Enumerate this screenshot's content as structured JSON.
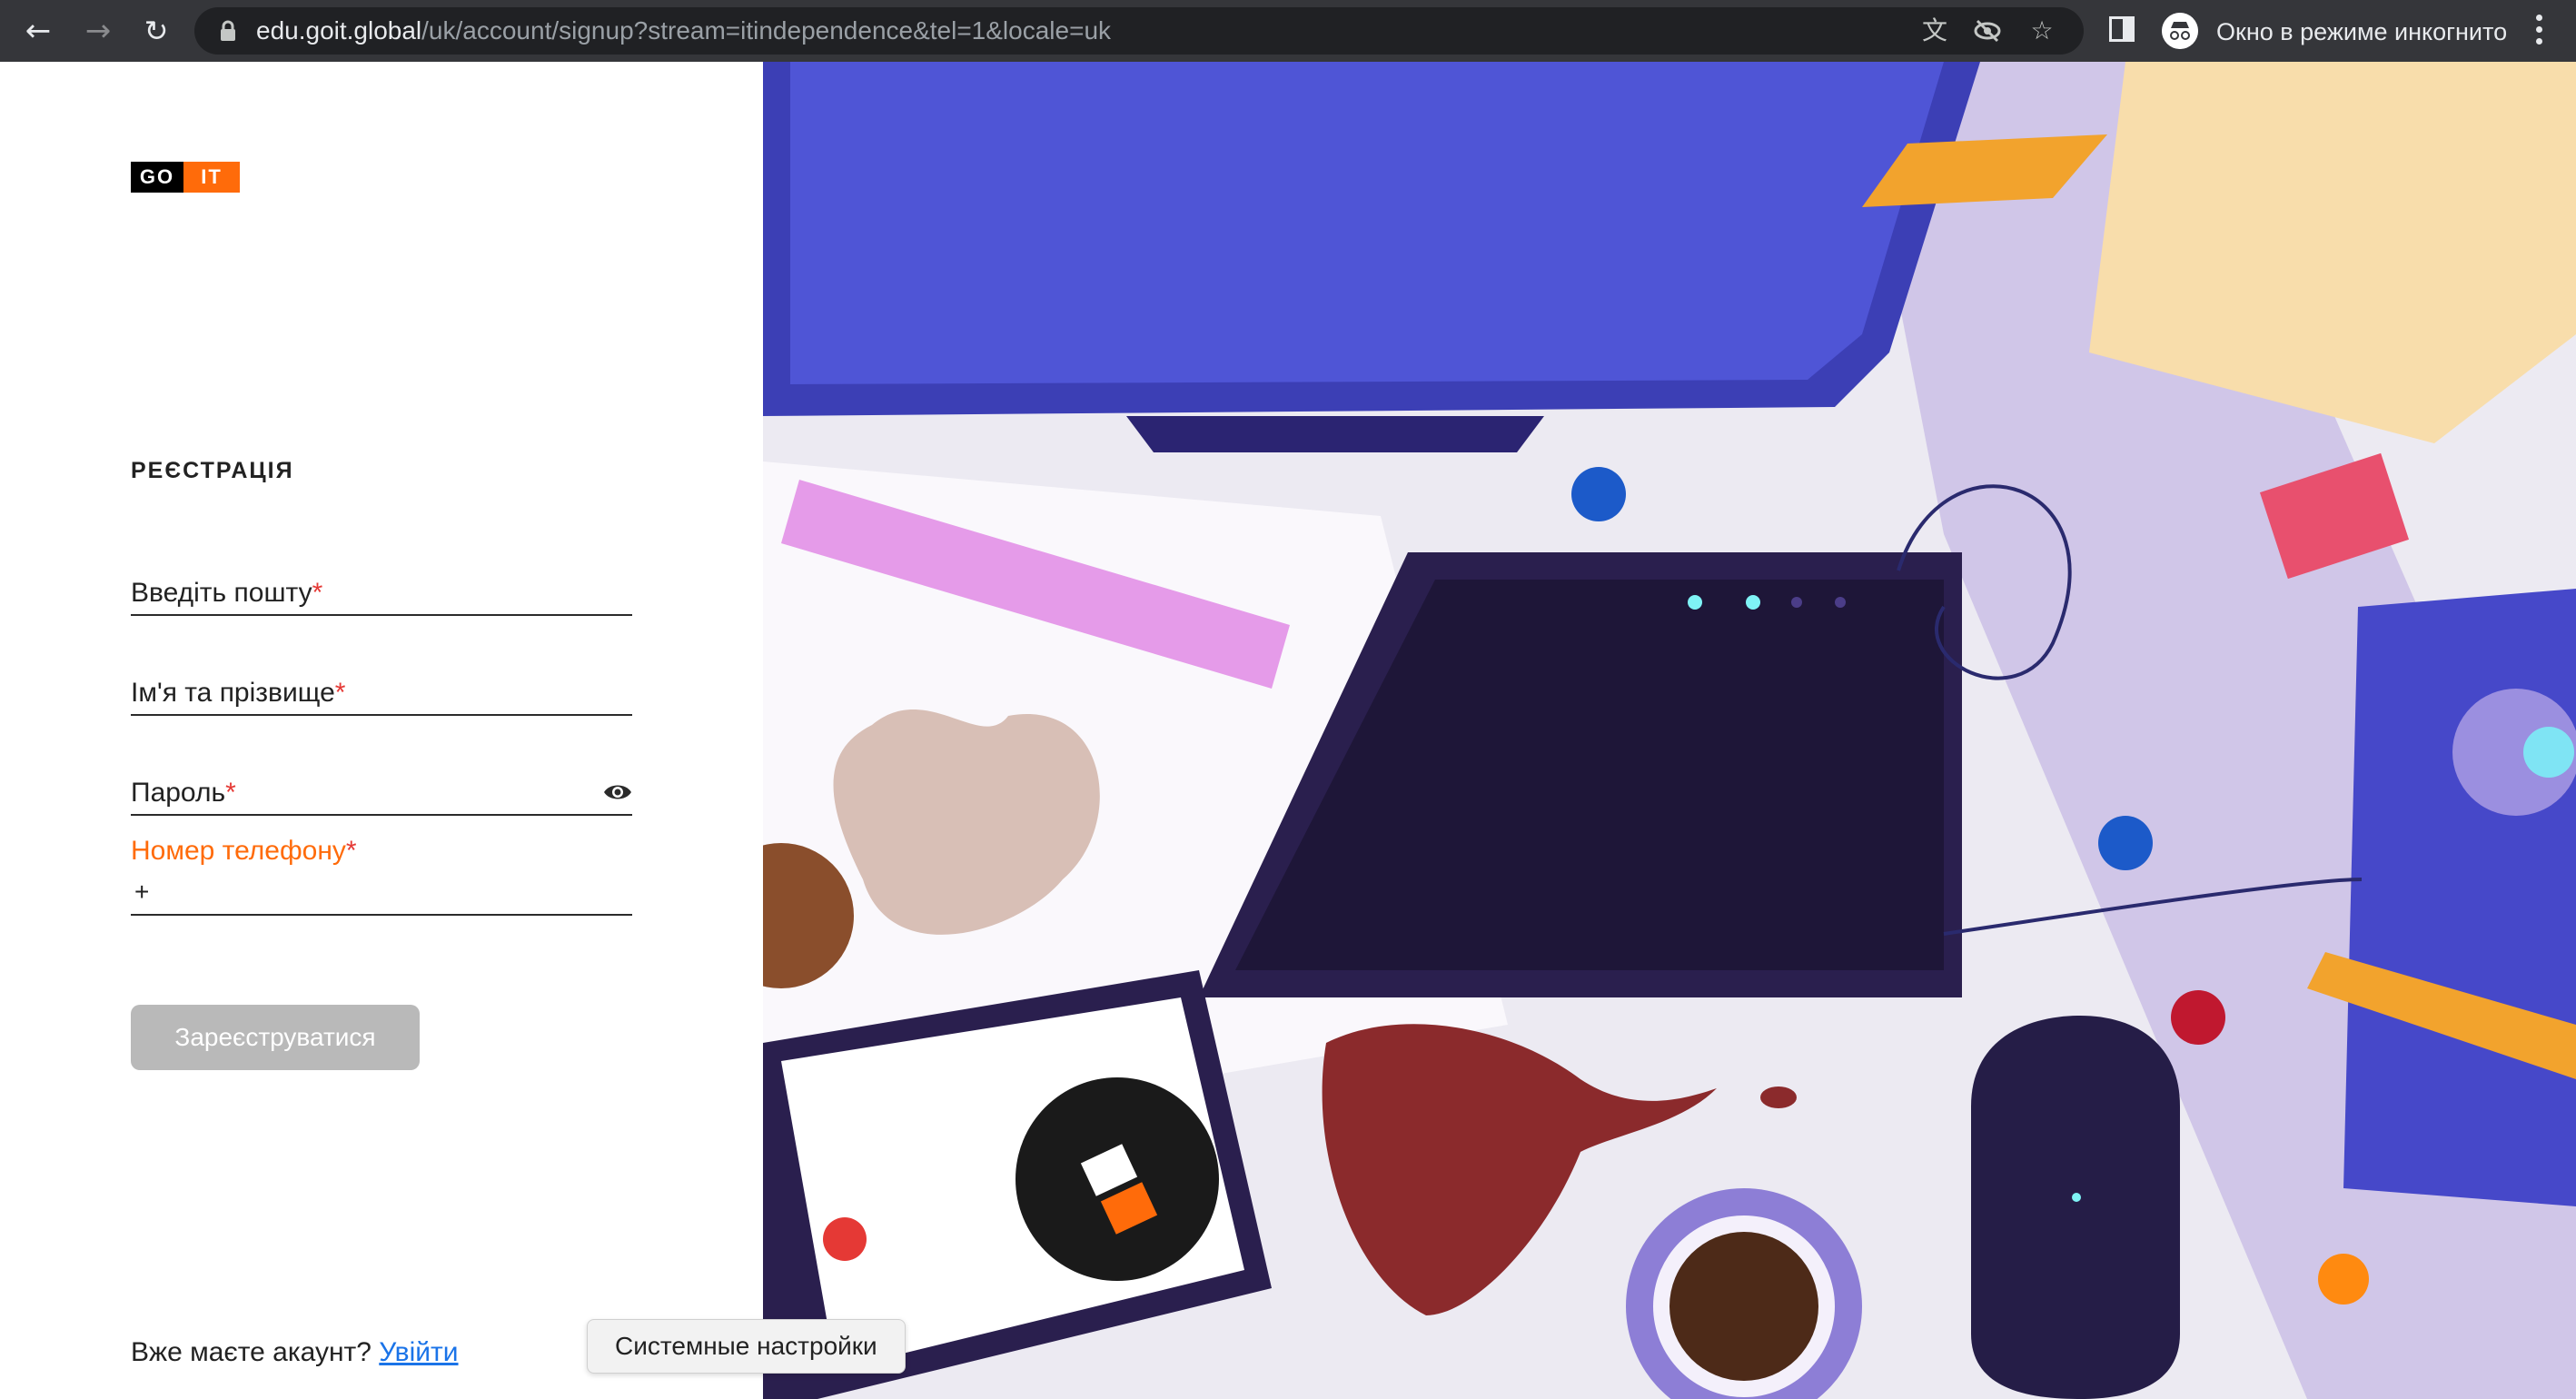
{
  "browser": {
    "url_host": "edu.goit.global",
    "url_path": "/uk/account/signup?stream=itindependence&tel=1&locale=uk",
    "incognito_label": "Окно в режиме инкогнито",
    "icons": [
      "back-icon",
      "forward-icon",
      "reload-icon",
      "lock-icon",
      "translate-icon",
      "eye-off-icon",
      "star-icon",
      "side-panel-icon",
      "incognito-icon",
      "more-icon"
    ]
  },
  "logo": {
    "go": "GO",
    "it": "IT"
  },
  "form": {
    "title": "РЕЄСТРАЦІЯ",
    "email_label": "Введіть пошту",
    "name_label": "Ім'я та прізвище",
    "password_label": "Пароль",
    "phone_label": "Номер телефону",
    "phone_prefix": "+",
    "required_mark": "*",
    "submit_label": "Зареєструватися",
    "have_account": "Вже маєте акаунт?",
    "login_link": "Увійти"
  },
  "colors": {
    "accent": "#ff6b0a",
    "required": "#e53935",
    "link": "#1a73e8",
    "button_disabled": "#b9b9b9"
  },
  "tooltip": {
    "text": "Системные настройки"
  }
}
